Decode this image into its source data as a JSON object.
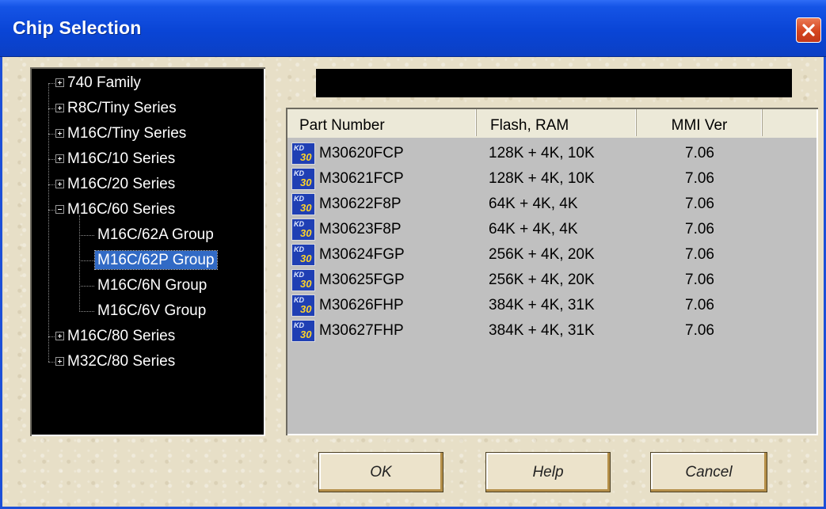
{
  "window": {
    "title": "Chip Selection"
  },
  "tree": {
    "items": [
      {
        "label": "740 Family",
        "expander": "plus"
      },
      {
        "label": "R8C/Tiny Series",
        "expander": "plus"
      },
      {
        "label": "M16C/Tiny Series",
        "expander": "plus"
      },
      {
        "label": "M16C/10 Series",
        "expander": "plus"
      },
      {
        "label": "M16C/20 Series",
        "expander": "plus"
      },
      {
        "label": "M16C/60 Series",
        "expander": "minus"
      },
      {
        "label": "M16C/62A Group",
        "child": true
      },
      {
        "label": "M16C/62P Group",
        "child": true,
        "selected": true
      },
      {
        "label": "M16C/6N Group",
        "child": true
      },
      {
        "label": "M16C/6V Group",
        "child": true
      },
      {
        "label": "M16C/80 Series",
        "expander": "plus"
      },
      {
        "label": "M32C/80 Series",
        "expander": "plus"
      }
    ]
  },
  "table": {
    "columns": [
      "Part Number",
      "Flash, RAM",
      "MMI Ver"
    ],
    "icon": {
      "name": "kd30-chip-icon",
      "top_text": "KD",
      "bottom_text": "30"
    },
    "rows": [
      {
        "part": "M30620FCP",
        "mem": "128K + 4K, 10K",
        "ver": "7.06"
      },
      {
        "part": "M30621FCP",
        "mem": "128K + 4K, 10K",
        "ver": "7.06"
      },
      {
        "part": "M30622F8P",
        "mem": "64K + 4K, 4K",
        "ver": "7.06"
      },
      {
        "part": "M30623F8P",
        "mem": "64K + 4K, 4K",
        "ver": "7.06"
      },
      {
        "part": "M30624FGP",
        "mem": "256K + 4K, 20K",
        "ver": "7.06"
      },
      {
        "part": "M30625FGP",
        "mem": "256K + 4K, 20K",
        "ver": "7.06"
      },
      {
        "part": "M30626FHP",
        "mem": "384K + 4K, 31K",
        "ver": "7.06"
      },
      {
        "part": "M30627FHP",
        "mem": "384K + 4K, 31K",
        "ver": "7.06"
      }
    ]
  },
  "buttons": {
    "ok": "OK",
    "help": "Help",
    "cancel": "Cancel"
  },
  "colors": {
    "titlebar": "#0a45d6",
    "selection": "#316ac5",
    "close": "#d5451f"
  }
}
